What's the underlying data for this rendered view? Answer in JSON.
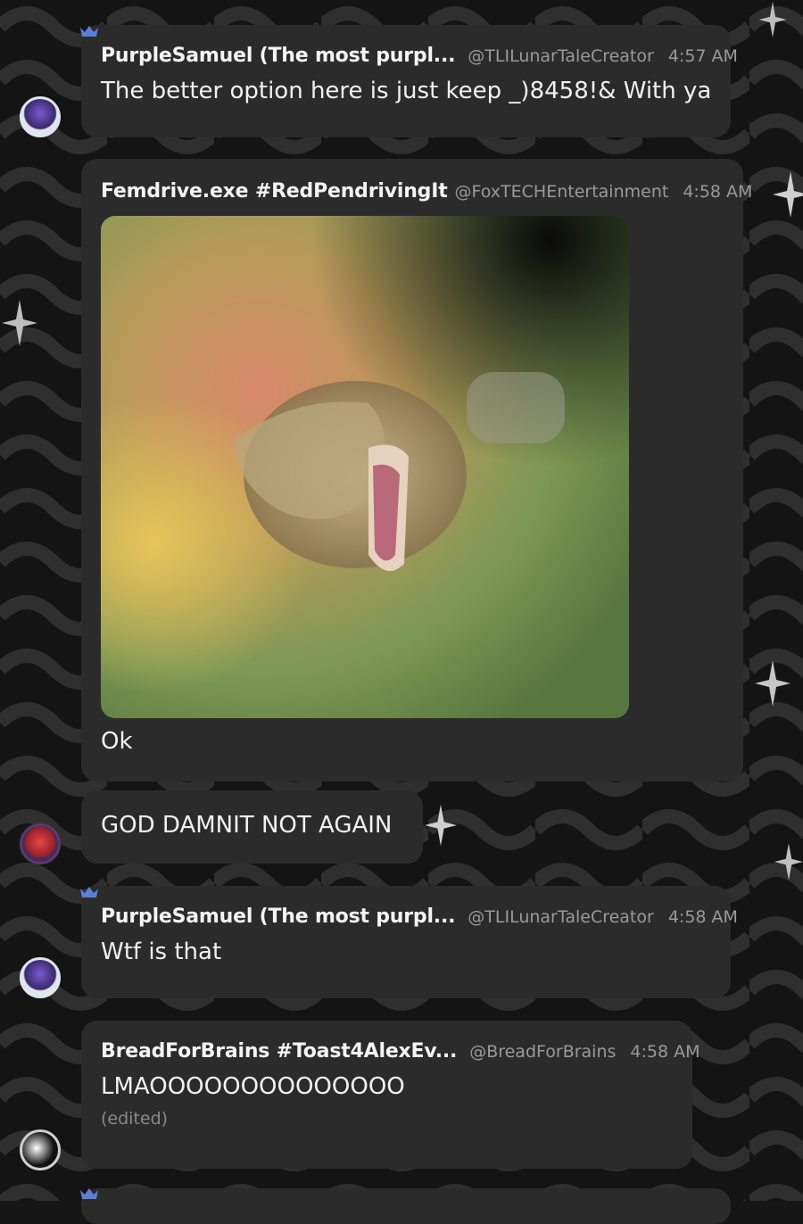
{
  "messages": [
    {
      "author": "PurpleSamuel (The most purpl...",
      "handle": "@TLILunarTaleCreator",
      "time": "4:57 AM",
      "text": "The better option here is just keep _)8458!& With ya"
    },
    {
      "author": "Femdrive.exe #RedPendrivingIt",
      "handle": "@FoxTECHEntertainment",
      "time": "4:58 AM",
      "text": "Ok",
      "attachment": "roaring-lion-image"
    },
    {
      "text": "GOD DAMNIT NOT AGAIN"
    },
    {
      "author": "PurpleSamuel (The most purpl...",
      "handle": "@TLILunarTaleCreator",
      "time": "4:58 AM",
      "text": "Wtf is that"
    },
    {
      "author": "BreadForBrains #Toast4AlexEv...",
      "handle": "@BreadForBrains",
      "time": "4:58 AM",
      "text": "LMAOOOOOOOOOOOOOO",
      "status": "(edited)"
    }
  ],
  "colors": {
    "bubble": "#2b2b2b",
    "background": "#161616",
    "muted_text": "#9a9a9a",
    "crown": "#5b7fd6"
  },
  "icons": {
    "crown": "crown-icon",
    "sparkle": "sparkle-icon"
  }
}
